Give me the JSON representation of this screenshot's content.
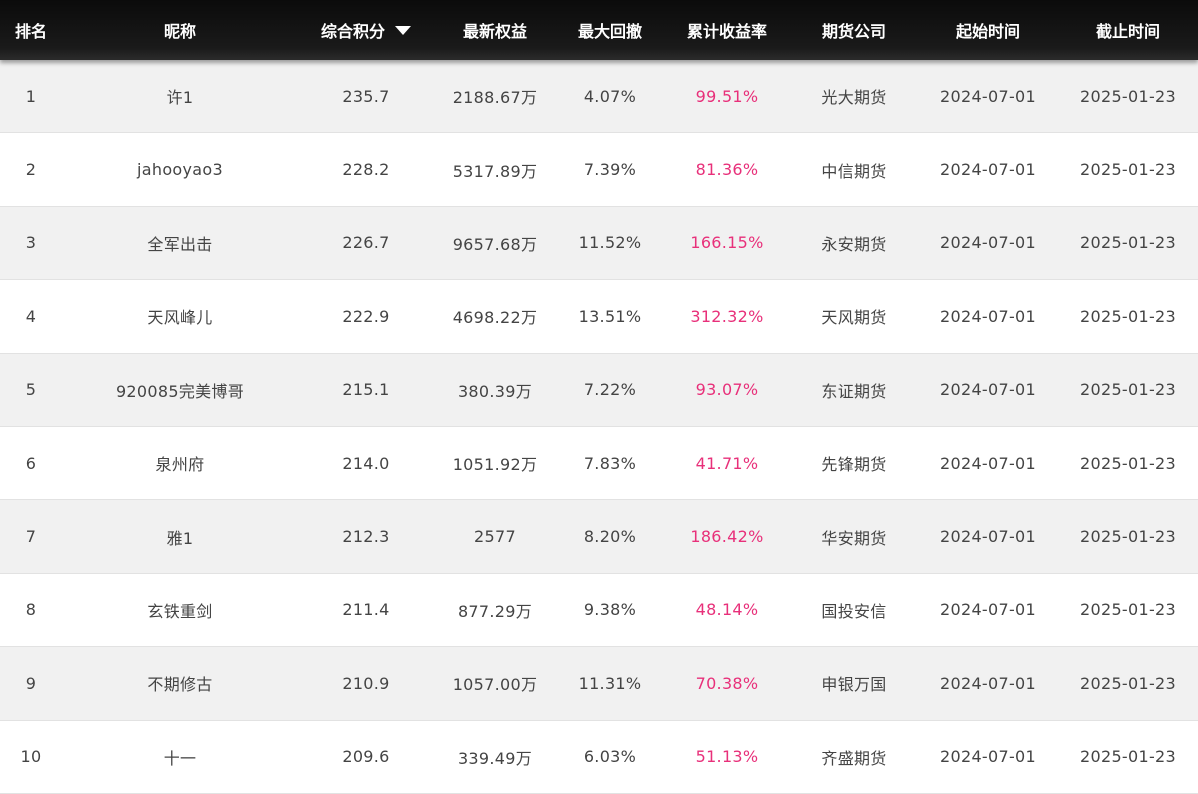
{
  "header": {
    "rank": "排名",
    "nickname": "昵称",
    "score": "综合积分",
    "equity": "最新权益",
    "drawdown": "最大回撤",
    "return_rate": "累计收益率",
    "company": "期货公司",
    "start_time": "起始时间",
    "end_time": "截止时间",
    "sort_icon": "caret-down-icon"
  },
  "colors": {
    "header_bg": "#111111",
    "odd_row_bg": "#f1f1f1",
    "even_row_bg": "#ffffff",
    "return_rate_text": "#e8307a",
    "body_text": "#444444"
  },
  "rows": [
    {
      "rank": "1",
      "nickname": "许1",
      "score": "235.7",
      "equity": "2188.67万",
      "drawdown": "4.07%",
      "return_rate": "99.51%",
      "company": "光大期货",
      "start": "2024-07-01",
      "end": "2025-01-23"
    },
    {
      "rank": "2",
      "nickname": "jahooyao3",
      "score": "228.2",
      "equity": "5317.89万",
      "drawdown": "7.39%",
      "return_rate": "81.36%",
      "company": "中信期货",
      "start": "2024-07-01",
      "end": "2025-01-23"
    },
    {
      "rank": "3",
      "nickname": "全军出击",
      "score": "226.7",
      "equity": "9657.68万",
      "drawdown": "11.52%",
      "return_rate": "166.15%",
      "company": "永安期货",
      "start": "2024-07-01",
      "end": "2025-01-23"
    },
    {
      "rank": "4",
      "nickname": "天风峰儿",
      "score": "222.9",
      "equity": "4698.22万",
      "drawdown": "13.51%",
      "return_rate": "312.32%",
      "company": "天风期货",
      "start": "2024-07-01",
      "end": "2025-01-23"
    },
    {
      "rank": "5",
      "nickname": "920085完美博哥",
      "score": "215.1",
      "equity": "380.39万",
      "drawdown": "7.22%",
      "return_rate": "93.07%",
      "company": "东证期货",
      "start": "2024-07-01",
      "end": "2025-01-23"
    },
    {
      "rank": "6",
      "nickname": "泉州府",
      "score": "214.0",
      "equity": "1051.92万",
      "drawdown": "7.83%",
      "return_rate": "41.71%",
      "company": "先锋期货",
      "start": "2024-07-01",
      "end": "2025-01-23"
    },
    {
      "rank": "7",
      "nickname": "雅1",
      "score": "212.3",
      "equity": "2577",
      "drawdown": "8.20%",
      "return_rate": "186.42%",
      "company": "华安期货",
      "start": "2024-07-01",
      "end": "2025-01-23"
    },
    {
      "rank": "8",
      "nickname": "玄铁重剑",
      "score": "211.4",
      "equity": "877.29万",
      "drawdown": "9.38%",
      "return_rate": "48.14%",
      "company": "国投安信",
      "start": "2024-07-01",
      "end": "2025-01-23"
    },
    {
      "rank": "9",
      "nickname": "不期修古",
      "score": "210.9",
      "equity": "1057.00万",
      "drawdown": "11.31%",
      "return_rate": "70.38%",
      "company": "申银万国",
      "start": "2024-07-01",
      "end": "2025-01-23"
    },
    {
      "rank": "10",
      "nickname": "十一",
      "score": "209.6",
      "equity": "339.49万",
      "drawdown": "6.03%",
      "return_rate": "51.13%",
      "company": "齐盛期货",
      "start": "2024-07-01",
      "end": "2025-01-23"
    }
  ]
}
